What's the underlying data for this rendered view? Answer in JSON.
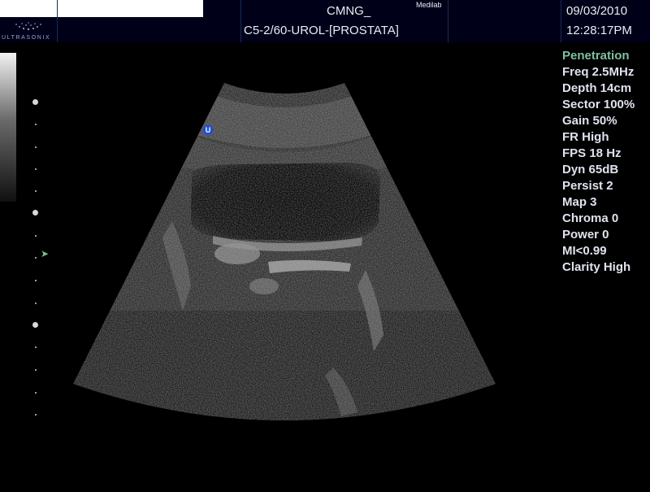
{
  "header": {
    "logo_text": "ULTRASONIX",
    "patient_name": "CMNG_",
    "site": "Medilab",
    "preset": "C5-2/60-UROL-[PROSTATA]",
    "date": "09/03/2010",
    "time": "12:28:17PM"
  },
  "image": {
    "orientation_marker": "U",
    "view": "transabdominal prostate / bladder ultrasound, grayscale B-mode"
  },
  "params": {
    "mode": "Penetration",
    "items": [
      "Freq 2.5MHz",
      "Depth 14cm",
      "Sector 100%",
      "Gain 50%",
      "FR High",
      "FPS 18 Hz",
      "Dyn 65dB",
      "Persist 2",
      "Map 3",
      "Chroma 0",
      "Power 0",
      "MI<0.99",
      "Clarity High"
    ]
  },
  "focus_marker": "➤"
}
